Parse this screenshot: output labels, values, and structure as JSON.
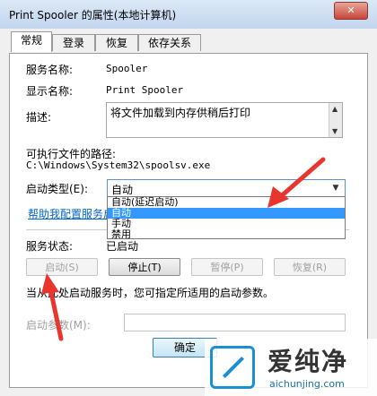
{
  "window": {
    "title": "Print Spooler 的属性(本地计算机)",
    "close_glyph": "✕"
  },
  "tabs": [
    "常规",
    "登录",
    "恢复",
    "依存关系"
  ],
  "general": {
    "service_name_label": "服务名称:",
    "service_name": "Spooler",
    "display_name_label": "显示名称:",
    "display_name": "Print Spooler",
    "description_label": "描述:",
    "description": "将文件加载到内存供稍后打印",
    "exe_path_label": "可执行文件的路径:",
    "exe_path": "C:\\Windows\\System32\\spoolsv.exe",
    "startup_type_label": "启动类型(E):",
    "startup_type_value": "自动",
    "startup_options": [
      "自动(延迟启动)",
      "自动",
      "手动",
      "禁用"
    ],
    "startup_selected_index": 1,
    "help_link": "帮助我配置服务启动",
    "service_status_label": "服务状态:",
    "service_status": "已启动",
    "buttons": {
      "start": "启动(S)",
      "stop": "停止(T)",
      "pause": "暂停(P)",
      "resume": "恢复(R)"
    },
    "hint": "当从此处启动服务时，您可指定所适用的启动参数。",
    "params_label": "启动参数(M):",
    "params_value": ""
  },
  "footer": {
    "ok_label": "确定"
  },
  "watermark": {
    "title": "爱纯净",
    "url": "aichunjing.com"
  },
  "colors": {
    "accent": "#3399ff",
    "link": "#0066cc",
    "annotation_arrow": "#e8362f",
    "watermark": "#1b8fd4"
  }
}
